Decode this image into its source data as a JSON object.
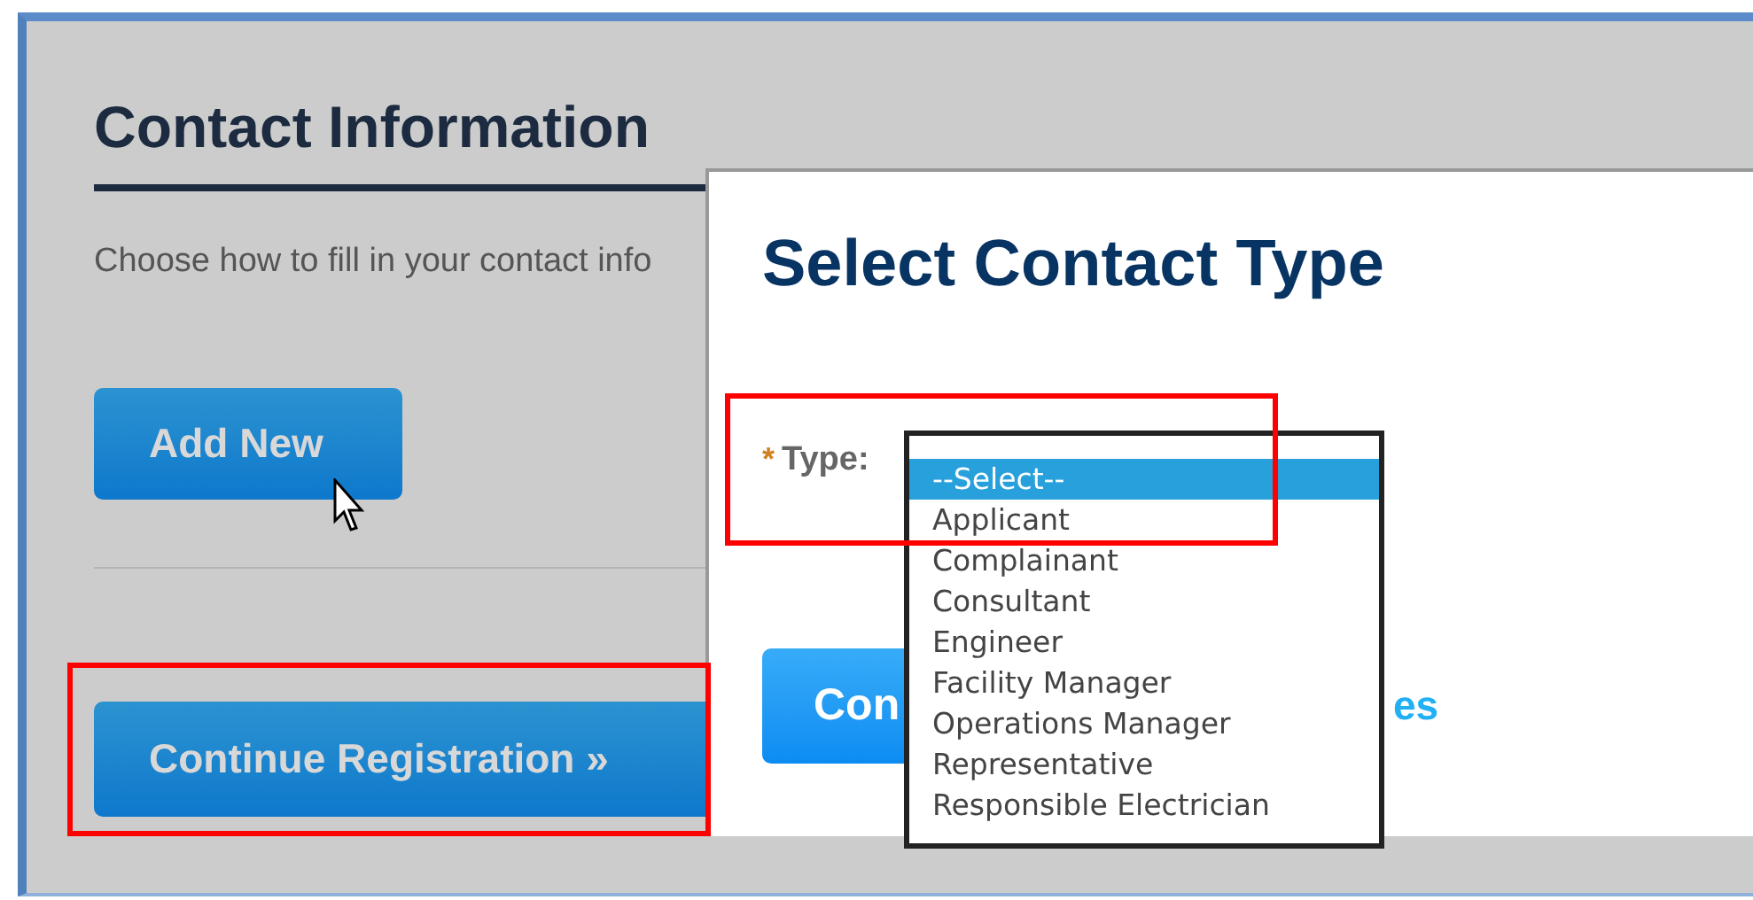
{
  "page": {
    "heading": "Contact Information",
    "instructions": "Choose how to fill in your contact info",
    "buttons": [
      {
        "label": "Add New"
      },
      {
        "label": "Continue Registration »"
      }
    ]
  },
  "dialog": {
    "title": "Select Contact Type",
    "field": {
      "required_mark": "*",
      "label": "Type:"
    },
    "options": [
      {
        "label": "--Select--",
        "selected": true
      },
      {
        "label": "Applicant",
        "selected": false
      },
      {
        "label": "Complainant",
        "selected": false
      },
      {
        "label": "Consultant",
        "selected": false
      },
      {
        "label": "Engineer",
        "selected": false
      },
      {
        "label": "Facility Manager",
        "selected": false
      },
      {
        "label": "Operations Manager",
        "selected": false
      },
      {
        "label": "Representative",
        "selected": false
      },
      {
        "label": "Responsible Electrician",
        "selected": false
      }
    ],
    "button": "Con",
    "link": "es"
  }
}
